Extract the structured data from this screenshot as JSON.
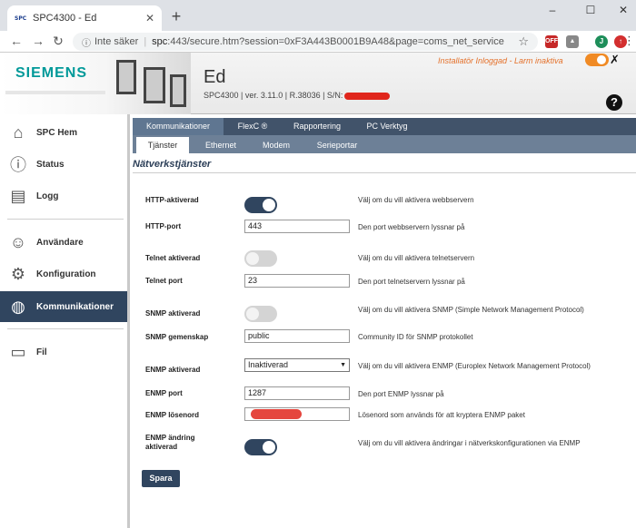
{
  "browser": {
    "tab_title": "SPC4300 - Ed",
    "tab_favicon": "SPC",
    "new_tab": "+",
    "close": "✕",
    "window_min": "–",
    "window_max": "☐",
    "window_close": "✕",
    "security_label": "Inte säker",
    "url_host": "spc",
    "url_path": ":443/secure.htm?session=0xF3A443B0001B9A48&page=coms_net_service",
    "profile_initial": "J"
  },
  "header": {
    "logo": "SIEMENS",
    "site_name": "Ed",
    "site_meta": "SPC4300  |  ver. 3.11.0  |  R.38036  |  S/N:",
    "status": "Installatör Inloggad - Larm inaktiva",
    "help": "?"
  },
  "sidebar": {
    "items": [
      {
        "label": "SPC Hem",
        "icon": "home-icon"
      },
      {
        "label": "Status",
        "icon": "info-icon"
      },
      {
        "label": "Logg",
        "icon": "document-icon"
      },
      {
        "label": "Användare",
        "icon": "user-icon"
      },
      {
        "label": "Konfiguration",
        "icon": "gear-icon"
      },
      {
        "label": "Kommunikationer",
        "icon": "globe-icon"
      },
      {
        "label": "Fil",
        "icon": "folder-icon"
      }
    ]
  },
  "tabs_main": [
    "Kommunikationer",
    "FlexC ®",
    "Rapportering",
    "PC Verktyg"
  ],
  "tabs_sub": [
    "Tjänster",
    "Ethernet",
    "Modem",
    "Serieportar"
  ],
  "section_title": "Nätverkstjänster",
  "form": {
    "http_enabled": {
      "label": "HTTP-aktiverad",
      "desc": "Välj om du vill aktivera webbservern"
    },
    "http_port": {
      "label": "HTTP-port",
      "value": "443",
      "desc": "Den port webbservern lyssnar på"
    },
    "telnet_enabled": {
      "label": "Telnet aktiverad",
      "desc": "Välj om du vill aktivera telnetservern"
    },
    "telnet_port": {
      "label": "Telnet port",
      "value": "23",
      "desc": "Den port telnetservern lyssnar på"
    },
    "snmp_enabled": {
      "label": "SNMP aktiverad",
      "desc": "Välj om du vill aktivera SNMP (Simple Network Management Protocol)"
    },
    "snmp_community": {
      "label": "SNMP gemenskap",
      "value": "public",
      "desc": "Community ID för SNMP protokollet"
    },
    "enmp_enabled": {
      "label": "ENMP aktiverad",
      "value": "Inaktiverad",
      "desc": "Välj om du vill aktivera ENMP (Europlex Network Management Protocol)"
    },
    "enmp_port": {
      "label": "ENMP port",
      "value": "1287",
      "desc": "Den port ENMP lyssnar på"
    },
    "enmp_password": {
      "label": "ENMP lösenord",
      "desc": "Lösenord som används för att kryptera ENMP paket"
    },
    "enmp_change": {
      "label": "ENMP ändring aktiverad",
      "desc": "Välj om du vill aktivera ändringar i nätverkskonfigurationen via ENMP"
    }
  },
  "save_label": "Spara",
  "colors": {
    "accent": "#30455f",
    "status": "#e4712b",
    "brand": "#009999"
  }
}
